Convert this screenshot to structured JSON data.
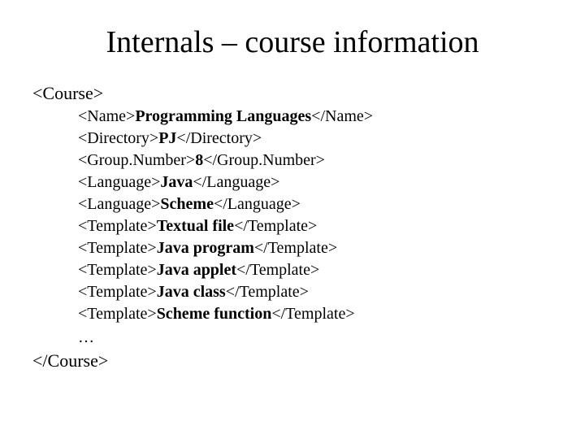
{
  "title": "Internals – course information",
  "open_tag": "<Course>",
  "close_tag": "</Course>",
  "ellipsis": "…",
  "entries": [
    {
      "tag": "Name",
      "value": "Programming Languages"
    },
    {
      "tag": "Directory",
      "value": "PJ"
    },
    {
      "tag": "Group.Number",
      "value": "8"
    },
    {
      "tag": "Language",
      "value": "Java"
    },
    {
      "tag": "Language",
      "value": "Scheme"
    },
    {
      "tag": "Template",
      "value": "Textual file"
    },
    {
      "tag": "Template",
      "value": "Java program"
    },
    {
      "tag": "Template",
      "value": "Java applet"
    },
    {
      "tag": "Template",
      "value": "Java class"
    },
    {
      "tag": "Template",
      "value": "Scheme function"
    }
  ]
}
